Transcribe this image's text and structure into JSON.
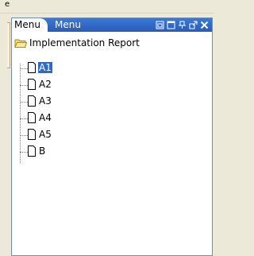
{
  "top_fragment": "e",
  "panel": {
    "active_tab": "Menu",
    "inactive_tab": "Menu",
    "header_icons": [
      "restore-icon",
      "maximize-icon",
      "pin-icon",
      "popout-icon",
      "close-icon"
    ]
  },
  "tree": {
    "root_label": "Implementation Report",
    "items": [
      {
        "label": "A1",
        "selected": true
      },
      {
        "label": "A2",
        "selected": false
      },
      {
        "label": "A3",
        "selected": false
      },
      {
        "label": "A4",
        "selected": false
      },
      {
        "label": "A5",
        "selected": false
      },
      {
        "label": "B",
        "selected": false
      }
    ]
  },
  "colors": {
    "header_blue": "#2a5cb6",
    "selection_blue": "#316ac5",
    "folder_yellow": "#f5d76e"
  }
}
